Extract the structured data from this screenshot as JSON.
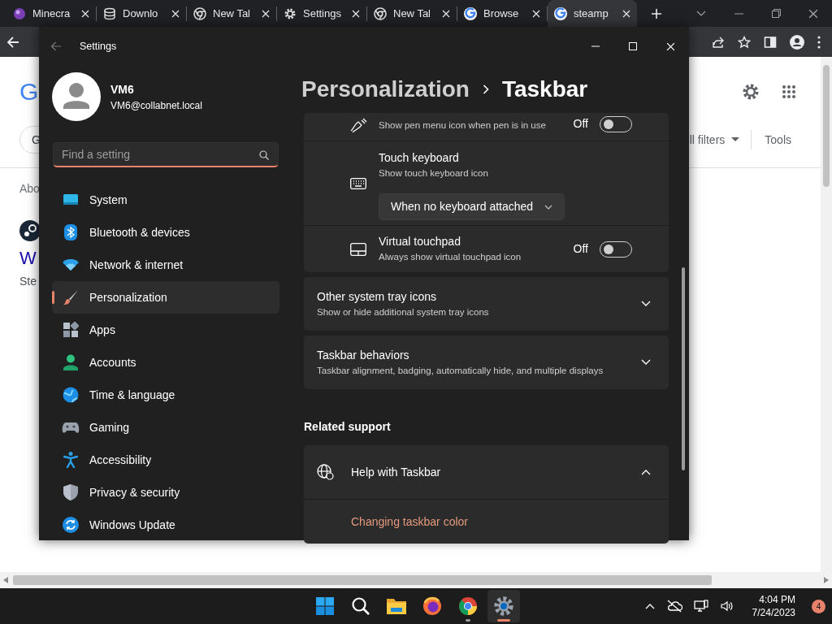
{
  "browser": {
    "tabs": [
      {
        "label": "Minecra",
        "selected": false
      },
      {
        "label": "Downlo",
        "selected": false
      },
      {
        "label": "New Tal",
        "selected": false
      },
      {
        "label": "Settings",
        "selected": false
      },
      {
        "label": "New Tal",
        "selected": false
      },
      {
        "label": "Browse",
        "selected": false
      },
      {
        "label": "steamp",
        "selected": true
      }
    ],
    "page": {
      "logo_fragment": "G",
      "chip_fragment": "G",
      "filters_label": "ll filters",
      "tools_label": "Tools",
      "results_fragment": "Abo",
      "result_title_fragment": "W",
      "result_source_fragment": "Ste"
    }
  },
  "settings": {
    "title": "Settings",
    "user": {
      "name": "VM6",
      "email": "VM6@collabnet.local"
    },
    "search": {
      "placeholder": "Find a setting"
    },
    "nav": [
      {
        "label": "System",
        "selected": false
      },
      {
        "label": "Bluetooth & devices",
        "selected": false
      },
      {
        "label": "Network & internet",
        "selected": false
      },
      {
        "label": "Personalization",
        "selected": true
      },
      {
        "label": "Apps",
        "selected": false
      },
      {
        "label": "Accounts",
        "selected": false
      },
      {
        "label": "Time & language",
        "selected": false
      },
      {
        "label": "Gaming",
        "selected": false
      },
      {
        "label": "Accessibility",
        "selected": false
      },
      {
        "label": "Privacy & security",
        "selected": false
      },
      {
        "label": "Windows Update",
        "selected": false
      }
    ],
    "breadcrumb": [
      "Personalization",
      "Taskbar"
    ],
    "tray_rows": [
      {
        "kind": "toggle",
        "description": "Show pen menu icon when pen is in use",
        "state_label": "Off",
        "on": false
      },
      {
        "kind": "dropdown",
        "title": "Touch keyboard",
        "description": "Show touch keyboard icon",
        "value": "When no keyboard attached"
      },
      {
        "kind": "toggle",
        "title": "Virtual touchpad",
        "description": "Always show virtual touchpad icon",
        "state_label": "Off",
        "on": false
      }
    ],
    "sections": [
      {
        "title": "Other system tray icons",
        "description": "Show or hide additional system tray icons",
        "expanded": false
      },
      {
        "title": "Taskbar behaviors",
        "description": "Taskbar alignment, badging, automatically hide, and multiple displays",
        "expanded": false
      }
    ],
    "related_heading": "Related support",
    "help": {
      "title": "Help with Taskbar",
      "expanded": true,
      "links": [
        "Changing taskbar color"
      ]
    }
  },
  "taskbar": {
    "apps": [
      {
        "running": false,
        "selected": false
      },
      {
        "running": false,
        "selected": false
      },
      {
        "running": false,
        "selected": false
      },
      {
        "running": false,
        "selected": false
      },
      {
        "running": true,
        "selected": false
      },
      {
        "running": true,
        "selected": true
      }
    ],
    "time": "4:04 PM",
    "date": "7/24/2023",
    "notification_count": "4"
  }
}
